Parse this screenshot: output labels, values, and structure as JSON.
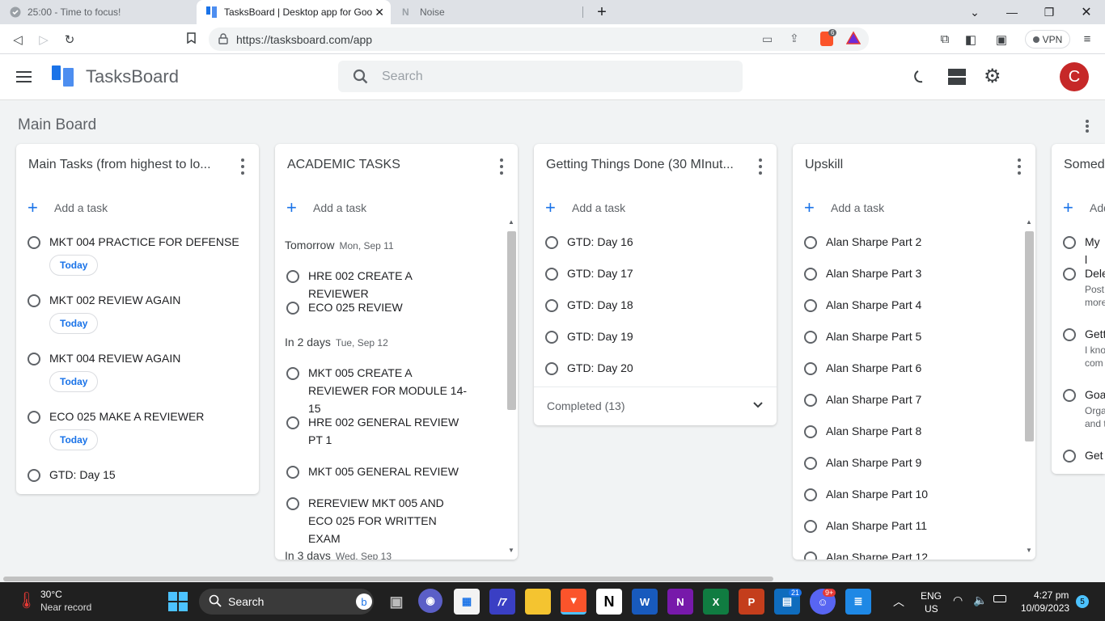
{
  "browser": {
    "tabs": [
      {
        "title": "25:00 - Time to focus!",
        "active": false
      },
      {
        "title": "TasksBoard | Desktop app for Goo",
        "active": true
      },
      {
        "title": "Noise",
        "active": false
      }
    ],
    "url": "https://tasksboard.com/app",
    "vpn_label": "VPN",
    "shield_badge": "6"
  },
  "app": {
    "name": "TasksBoard",
    "search_placeholder": "Search",
    "avatar_letter": "C",
    "board_title": "Main Board"
  },
  "columns": [
    {
      "title": "Main Tasks (from highest to lo...",
      "add_label": "Add a task",
      "tasks": [
        {
          "text": "MKT 004 PRACTICE FOR DEFENSE",
          "chip": "Today"
        },
        {
          "text": "MKT 002 REVIEW AGAIN",
          "chip": "Today"
        },
        {
          "text": "MKT 004 REVIEW AGAIN",
          "chip": "Today"
        },
        {
          "text": "ECO 025 MAKE A REVIEWER",
          "chip": "Today"
        },
        {
          "text": "GTD: Day 15"
        }
      ]
    },
    {
      "title": "ACADEMIC TASKS",
      "add_label": "Add a task",
      "groups": [
        {
          "label": "Tomorrow",
          "date": "Mon, Sep 11"
        },
        {
          "label": "In 2 days",
          "date": "Tue, Sep 12"
        },
        {
          "label": "In 3 days",
          "date": "Wed, Sep 13"
        }
      ],
      "tasks": [
        {
          "text": "HRE 002 CREATE A REVIEWER"
        },
        {
          "text": "ECO 025 REVIEW"
        },
        {
          "text": "MKT 005 CREATE A REVIEWER FOR MODULE 14-15"
        },
        {
          "text": "HRE 002 GENERAL REVIEW PT 1"
        },
        {
          "text": "MKT 005 GENERAL REVIEW"
        },
        {
          "text": "REREVIEW MKT 005 AND ECO 025 FOR WRITTEN EXAM"
        }
      ]
    },
    {
      "title": "Getting Things Done (30 MInut...",
      "add_label": "Add a task",
      "tasks": [
        {
          "text": "GTD: Day 16"
        },
        {
          "text": "GTD: Day 17"
        },
        {
          "text": "GTD: Day 18"
        },
        {
          "text": "GTD: Day 19"
        },
        {
          "text": "GTD: Day 20"
        }
      ],
      "completed_label": "Completed (13)"
    },
    {
      "title": "Upskill",
      "add_label": "Add a task",
      "tasks": [
        {
          "text": "Alan Sharpe Part 2"
        },
        {
          "text": "Alan Sharpe Part 3"
        },
        {
          "text": "Alan Sharpe Part 4"
        },
        {
          "text": "Alan Sharpe Part 5"
        },
        {
          "text": "Alan Sharpe Part 6"
        },
        {
          "text": "Alan Sharpe Part 7"
        },
        {
          "text": "Alan Sharpe Part 8"
        },
        {
          "text": "Alan Sharpe Part 9"
        },
        {
          "text": "Alan Sharpe Part 10"
        },
        {
          "text": "Alan Sharpe Part 11"
        },
        {
          "text": "Alan Sharpe Part 12"
        }
      ]
    },
    {
      "title": "Somed",
      "add_label": "Add",
      "tasks": [
        {
          "text": "My l"
        },
        {
          "text": "Dele",
          "note": "Post\nmore"
        },
        {
          "text": "Gett",
          "note": "I kno\ncom"
        },
        {
          "text": "Goa",
          "note": "Orga\nand t"
        },
        {
          "text": "Get"
        }
      ]
    }
  ],
  "taskbar": {
    "weather_temp": "30°C",
    "weather_desc": "Near record",
    "search_label": "Search",
    "lang_top": "ENG",
    "lang_bottom": "US",
    "time": "4:27 pm",
    "date": "10/09/2023",
    "notif_count": "5",
    "badge_21": "21",
    "badge_9": "9+"
  },
  "colors": {
    "accent": "#1a73e8",
    "avatar": "#c62828",
    "logo_dark": "#1a73e8",
    "logo_light": "#4d8ef0"
  }
}
